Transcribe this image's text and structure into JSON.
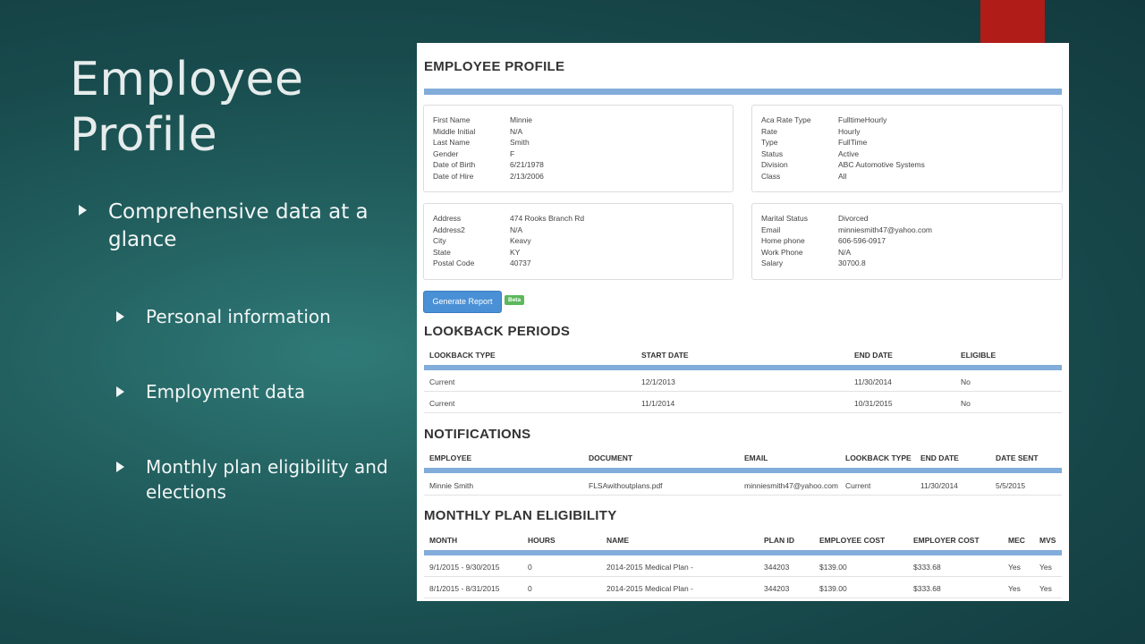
{
  "slide": {
    "title": "Employee\nProfile",
    "bullets": [
      "Comprehensive data at a glance",
      "Personal information",
      "Employment data",
      "Monthly plan eligibility and elections"
    ]
  },
  "profile": {
    "heading": "EMPLOYEE PROFILE",
    "card1": [
      {
        "k": "First Name",
        "v": "Minnie"
      },
      {
        "k": "Middle Initial",
        "v": "N/A"
      },
      {
        "k": "Last Name",
        "v": "Smith"
      },
      {
        "k": "Gender",
        "v": "F"
      },
      {
        "k": "Date of Birth",
        "v": "6/21/1978"
      },
      {
        "k": "Date of Hire",
        "v": "2/13/2006"
      }
    ],
    "card2": [
      {
        "k": "Aca Rate Type",
        "v": "FulltimeHourly"
      },
      {
        "k": "Rate",
        "v": "Hourly"
      },
      {
        "k": "Type",
        "v": "FullTime"
      },
      {
        "k": "Status",
        "v": "Active"
      },
      {
        "k": "Division",
        "v": "ABC Automotive Systems"
      },
      {
        "k": "Class",
        "v": "All"
      }
    ],
    "card3": [
      {
        "k": "Address",
        "v": "474 Rooks Branch Rd"
      },
      {
        "k": "Address2",
        "v": "N/A"
      },
      {
        "k": "City",
        "v": "Keavy"
      },
      {
        "k": "State",
        "v": "KY"
      },
      {
        "k": "Postal Code",
        "v": "40737"
      }
    ],
    "card4": [
      {
        "k": "Marital Status",
        "v": "Divorced"
      },
      {
        "k": "Email",
        "v": "minniesmith47@yahoo.com"
      },
      {
        "k": "Home phone",
        "v": "606-596-0917"
      },
      {
        "k": "Work Phone",
        "v": "N/A"
      },
      {
        "k": "Salary",
        "v": "30700.8"
      }
    ],
    "generate_button": "Generate Report",
    "beta_badge": "Beta"
  },
  "lookback": {
    "heading": "LOOKBACK PERIODS",
    "columns": [
      "LOOKBACK TYPE",
      "START DATE",
      "END DATE",
      "ELIGIBLE"
    ],
    "rows": [
      [
        "Current",
        "12/1/2013",
        "11/30/2014",
        "No"
      ],
      [
        "Current",
        "11/1/2014",
        "10/31/2015",
        "No"
      ]
    ]
  },
  "notifications": {
    "heading": "NOTIFICATIONS",
    "columns": [
      "EMPLOYEE",
      "DOCUMENT",
      "EMAIL",
      "LOOKBACK TYPE",
      "END DATE",
      "DATE SENT"
    ],
    "rows": [
      [
        "Minnie Smith",
        "FLSAwithoutplans.pdf",
        "minniesmith47@yahoo.com",
        "Current",
        "11/30/2014",
        "5/5/2015"
      ]
    ]
  },
  "eligibility": {
    "heading": "MONTHLY PLAN ELIGIBILITY",
    "columns": [
      "MONTH",
      "HOURS",
      "NAME",
      "PLAN ID",
      "EMPLOYEE COST",
      "EMPLOYER COST",
      "MEC",
      "MVS"
    ],
    "rows": [
      [
        "9/1/2015 - 9/30/2015",
        "0",
        "2014-2015 Medical Plan -",
        "344203",
        "$139.00",
        "$333.68",
        "Yes",
        "Yes"
      ],
      [
        "8/1/2015 - 8/31/2015",
        "0",
        "2014-2015 Medical Plan -",
        "344203",
        "$139.00",
        "$333.68",
        "Yes",
        "Yes"
      ]
    ]
  },
  "colors": {
    "accent_bar": "#82acd9",
    "button": "#4a90d6",
    "beta": "#5cb85c",
    "red_tab": "#b01c17"
  }
}
